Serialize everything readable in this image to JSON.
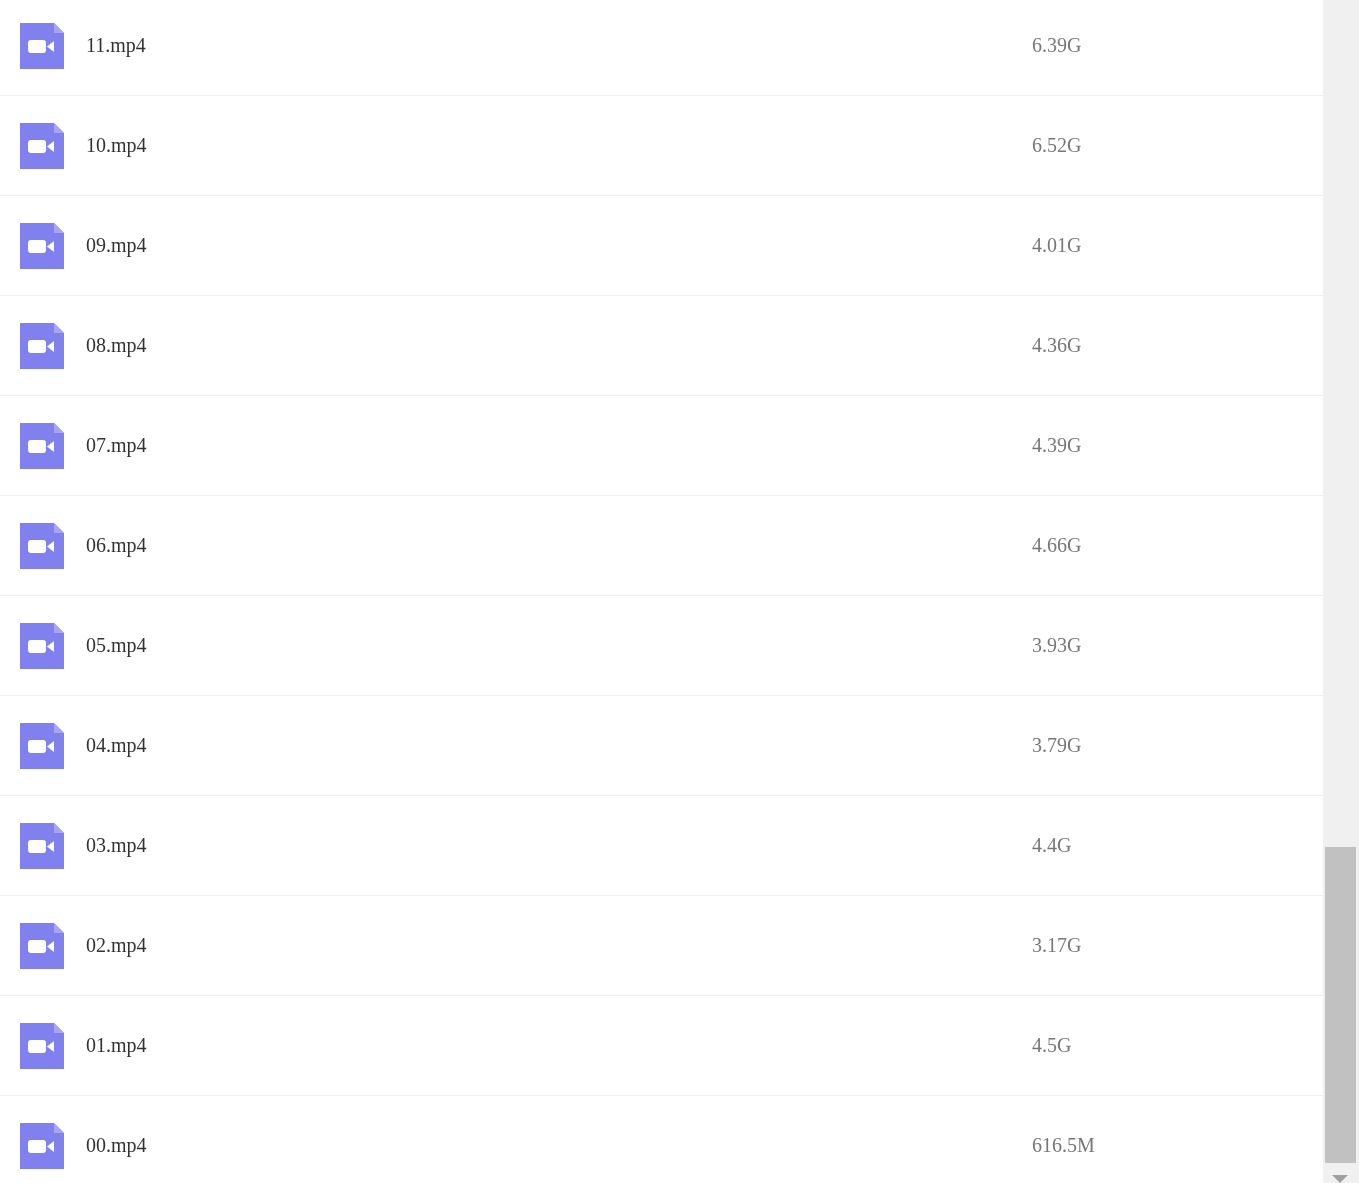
{
  "files": [
    {
      "name": "11.mp4",
      "size": "6.39G"
    },
    {
      "name": "10.mp4",
      "size": "6.52G"
    },
    {
      "name": "09.mp4",
      "size": "4.01G"
    },
    {
      "name": "08.mp4",
      "size": "4.36G"
    },
    {
      "name": "07.mp4",
      "size": "4.39G"
    },
    {
      "name": "06.mp4",
      "size": "4.66G"
    },
    {
      "name": "05.mp4",
      "size": "3.93G"
    },
    {
      "name": "04.mp4",
      "size": "3.79G"
    },
    {
      "name": "03.mp4",
      "size": "4.4G"
    },
    {
      "name": "02.mp4",
      "size": "3.17G"
    },
    {
      "name": "01.mp4",
      "size": "4.5G"
    },
    {
      "name": "00.mp4",
      "size": "616.5M"
    }
  ]
}
